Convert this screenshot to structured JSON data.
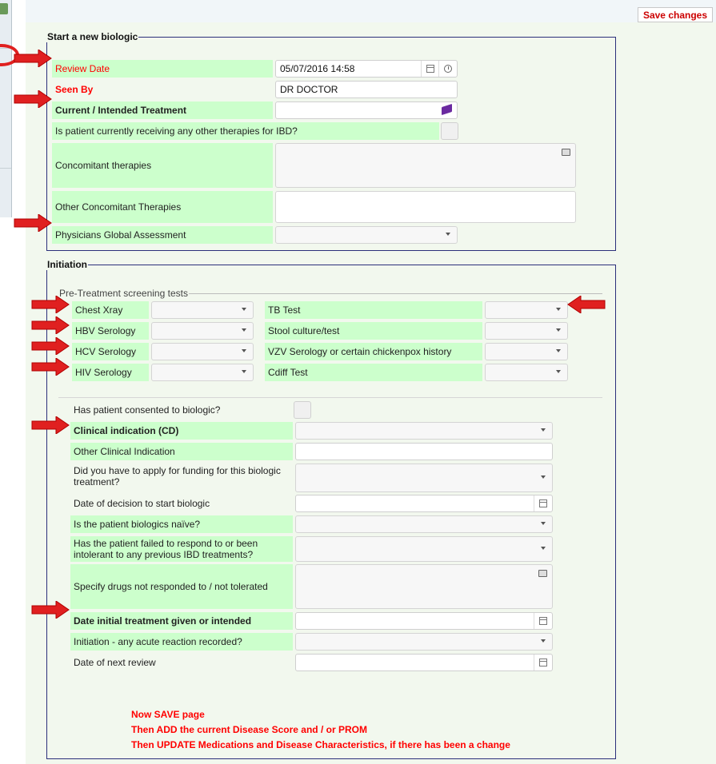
{
  "toolbar": {
    "save_label": "Save changes"
  },
  "section1": {
    "legend": "Start a new biologic",
    "review_date_label": "Review Date",
    "review_date_value": "05/07/2016 14:58",
    "seen_by_label": "Seen By",
    "seen_by_value": "DR DOCTOR",
    "treatment_label": "Current / Intended Treatment",
    "other_therapies_label": "Is patient currently receiving any other therapies for IBD?",
    "concomitant_label": "Concomitant therapies",
    "other_concomitant_label": "Other Concomitant Therapies",
    "pga_label": "Physicians Global Assessment"
  },
  "section2": {
    "legend": "Initiation",
    "screening_legend": "Pre-Treatment screening tests",
    "tests_left": [
      "Chest Xray",
      "HBV Serology",
      "HCV Serology",
      "HIV Serology"
    ],
    "tests_right": [
      "TB Test",
      "Stool culture/test",
      "VZV Serology or certain chickenpox history",
      "Cdiff Test"
    ],
    "consent_label": "Has patient consented to biologic?",
    "clinical_indication_label": "Clinical indication (CD)",
    "other_clinical_label": "Other Clinical Indication",
    "funding_label": "Did you have to apply for funding for this biologic treatment?",
    "decision_date_label": "Date of decision to start biologic",
    "naive_label": "Is the patient biologics naïve?",
    "failed_label": "Has the patient failed to respond to or been intolerant to any previous IBD treatments?",
    "specify_drugs_label": "Specify drugs not responded to / not tolerated",
    "initial_date_label": "Date initial treatment given or intended",
    "acute_reaction_label": "Initiation - any acute reaction recorded?",
    "next_review_label": "Date of next review"
  },
  "notes": [
    "Now SAVE page",
    "Then ADD the current Disease Score and / or PROM",
    "Then UPDATE Medications and Disease Characteristics, if there has been a change"
  ],
  "colors": {
    "label_bg": "#ccffcc",
    "required_text": "#ff0000",
    "border": "#2b2f7a",
    "arrow": "#e02020"
  }
}
